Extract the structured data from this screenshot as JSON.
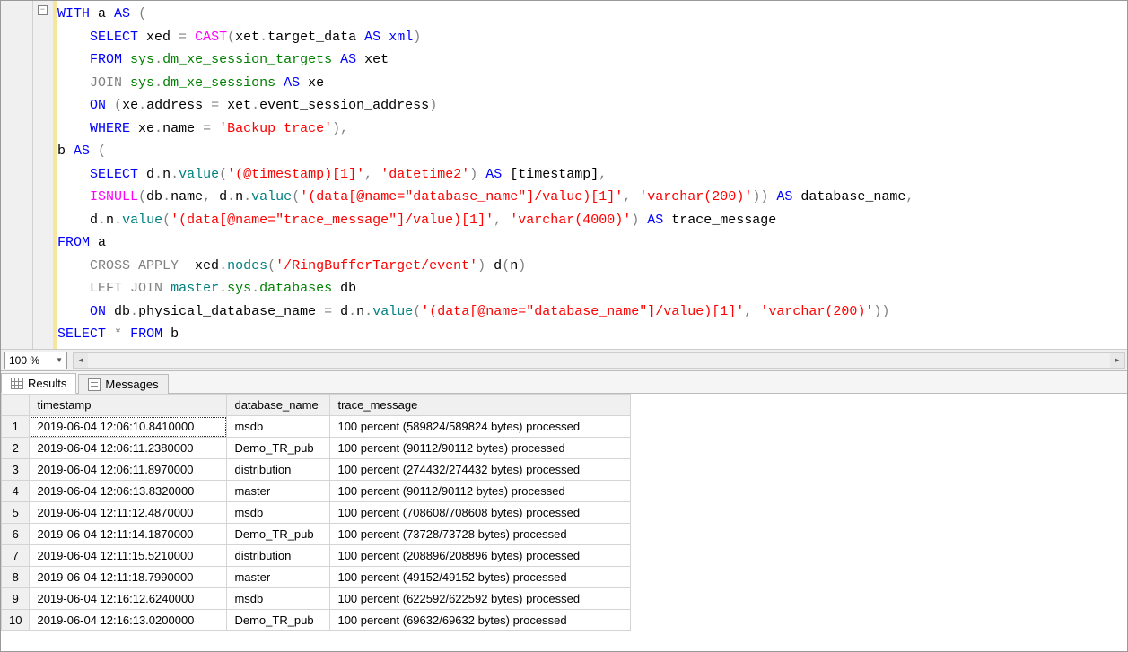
{
  "editor": {
    "fold_glyph": "−",
    "lines_html": [
      "<span class='kw'>WITH</span> a <span class='kw'>AS</span> <span class='op'>(</span>",
      "    <span class='kw'>SELECT</span> xed <span class='op'>=</span> <span class='fn'>CAST</span><span class='op'>(</span>xet<span class='op'>.</span>target_data <span class='kw'>AS</span> <span class='kw'>xml</span><span class='op'>)</span>",
      "    <span class='kw'>FROM</span> <span class='sys'>sys</span><span class='op'>.</span><span class='sys'>dm_xe_session_targets</span> <span class='kw'>AS</span> xet",
      "    <span class='gray'>JOIN</span> <span class='sys'>sys</span><span class='op'>.</span><span class='sys'>dm_xe_sessions</span> <span class='kw'>AS</span> xe",
      "    <span class='kw'>ON</span> <span class='op'>(</span>xe<span class='op'>.</span>address <span class='op'>=</span> xet<span class='op'>.</span>event_session_address<span class='op'>)</span>",
      "    <span class='kw'>WHERE</span> xe<span class='op'>.</span>name <span class='op'>=</span> <span class='str'>'Backup trace'</span><span class='op'>),</span>",
      "b <span class='kw'>AS</span> <span class='op'>(</span>",
      "    <span class='kw'>SELECT</span> d<span class='op'>.</span>n<span class='op'>.</span><span class='ident'>value</span><span class='op'>(</span><span class='str'>'(@timestamp)[1]'</span><span class='op'>,</span> <span class='str'>'datetime2'</span><span class='op'>)</span> <span class='kw'>AS</span> [timestamp]<span class='op'>,</span>",
      "    <span class='fn'>ISNULL</span><span class='op'>(</span>db<span class='op'>.</span>name<span class='op'>,</span> d<span class='op'>.</span>n<span class='op'>.</span><span class='ident'>value</span><span class='op'>(</span><span class='str'>'(data[@name=\"database_name\"]/value)[1]'</span><span class='op'>,</span> <span class='str'>'varchar(200)'</span><span class='op'>))</span> <span class='kw'>AS</span> database_name<span class='op'>,</span>",
      "    d<span class='op'>.</span>n<span class='op'>.</span><span class='ident'>value</span><span class='op'>(</span><span class='str'>'(data[@name=\"trace_message\"]/value)[1]'</span><span class='op'>,</span> <span class='str'>'varchar(4000)'</span><span class='op'>)</span> <span class='kw'>AS</span> trace_message",
      "<span class='kw'>FROM</span> a",
      "    <span class='gray'>CROSS APPLY</span>  xed<span class='op'>.</span><span class='ident'>nodes</span><span class='op'>(</span><span class='str'>'/RingBufferTarget/event'</span><span class='op'>)</span> d<span class='op'>(</span>n<span class='op'>)</span>",
      "    <span class='gray'>LEFT</span> <span class='gray'>JOIN</span> <span class='ident'>master</span><span class='op'>.</span><span class='sys'>sys</span><span class='op'>.</span><span class='sys'>databases</span> db",
      "    <span class='kw'>ON</span> db<span class='op'>.</span>physical_database_name <span class='op'>=</span> d<span class='op'>.</span>n<span class='op'>.</span><span class='ident'>value</span><span class='op'>(</span><span class='str'>'(data[@name=\"database_name\"]/value)[1]'</span><span class='op'>,</span> <span class='str'>'varchar(200)'</span><span class='op'>))</span>",
      "<span class='kw'>SELECT</span> <span class='op'>*</span> <span class='kw'>FROM</span> b"
    ]
  },
  "zoom": {
    "value": "100 %"
  },
  "tabs": {
    "results": "Results",
    "messages": "Messages"
  },
  "results": {
    "headers": [
      "",
      "timestamp",
      "database_name",
      "trace_message"
    ],
    "rows": [
      [
        "1",
        "2019-06-04 12:06:10.8410000",
        "msdb",
        "100 percent (589824/589824 bytes) processed"
      ],
      [
        "2",
        "2019-06-04 12:06:11.2380000",
        "Demo_TR_pub",
        "100 percent (90112/90112 bytes) processed"
      ],
      [
        "3",
        "2019-06-04 12:06:11.8970000",
        "distribution",
        "100 percent (274432/274432 bytes) processed"
      ],
      [
        "4",
        "2019-06-04 12:06:13.8320000",
        "master",
        "100 percent (90112/90112 bytes) processed"
      ],
      [
        "5",
        "2019-06-04 12:11:12.4870000",
        "msdb",
        "100 percent (708608/708608 bytes) processed"
      ],
      [
        "6",
        "2019-06-04 12:11:14.1870000",
        "Demo_TR_pub",
        "100 percent (73728/73728 bytes) processed"
      ],
      [
        "7",
        "2019-06-04 12:11:15.5210000",
        "distribution",
        "100 percent (208896/208896 bytes) processed"
      ],
      [
        "8",
        "2019-06-04 12:11:18.7990000",
        "master",
        "100 percent (49152/49152 bytes) processed"
      ],
      [
        "9",
        "2019-06-04 12:16:12.6240000",
        "msdb",
        "100 percent (622592/622592 bytes) processed"
      ],
      [
        "10",
        "2019-06-04 12:16:13.0200000",
        "Demo_TR_pub",
        "100 percent (69632/69632 bytes) processed"
      ]
    ]
  }
}
